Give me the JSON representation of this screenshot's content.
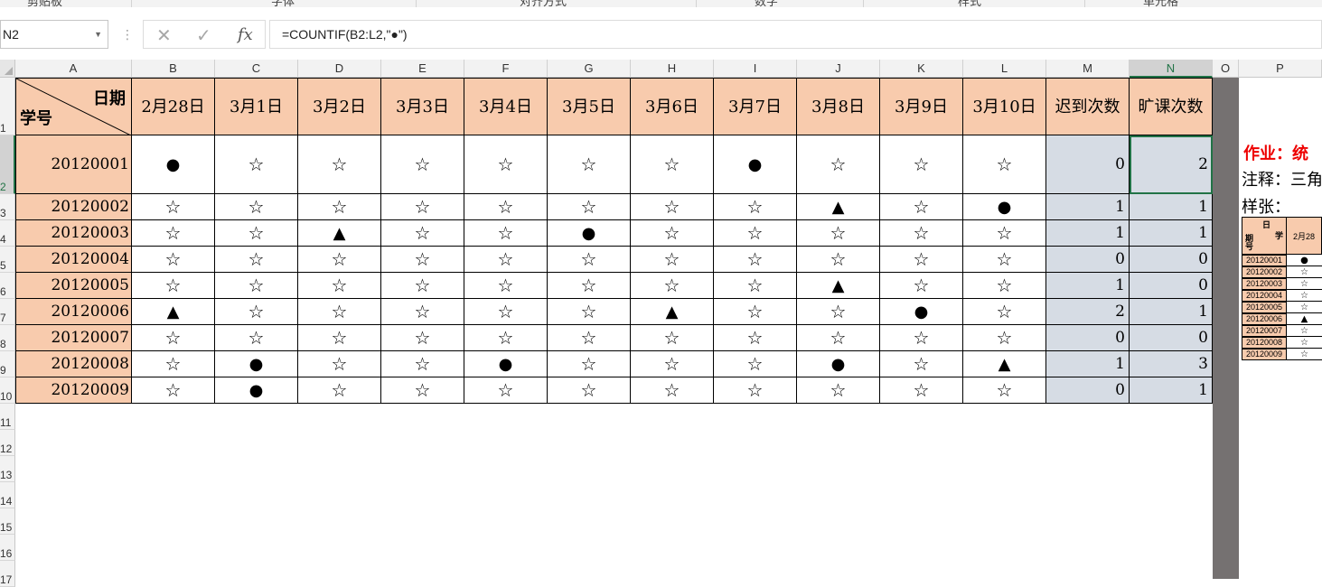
{
  "ribbon": {
    "groups": [
      "剪贴板",
      "字体",
      "对齐方式",
      "数字",
      "样式",
      "单元格"
    ]
  },
  "formula_bar": {
    "name_box": "N2",
    "cancel_icon": "x-icon",
    "enter_icon": "check-icon",
    "fx_label": "fx",
    "formula": "=COUNTIF(B2:L2,\"●\")"
  },
  "columns": [
    "A",
    "B",
    "C",
    "D",
    "E",
    "F",
    "G",
    "H",
    "I",
    "J",
    "K",
    "L",
    "M",
    "N",
    "O",
    "P"
  ],
  "selected_column": "N",
  "rows": [
    "1",
    "2",
    "3",
    "4",
    "5",
    "6",
    "7",
    "8",
    "9",
    "10",
    "11",
    "12",
    "13",
    "14",
    "15",
    "16",
    "17"
  ],
  "selected_row": "2",
  "table": {
    "corner_top": "日期",
    "corner_bottom": "学号",
    "dates": [
      "2月28日",
      "3月1日",
      "3月2日",
      "3月3日",
      "3月4日",
      "3月5日",
      "3月6日",
      "3月7日",
      "3月8日",
      "3月9日",
      "3月10日"
    ],
    "late_header": "迟到次数",
    "absent_header": "旷课次数",
    "records": [
      {
        "id": "20120001",
        "marks": [
          "●",
          "☆",
          "☆",
          "☆",
          "☆",
          "☆",
          "☆",
          "●",
          "☆",
          "☆",
          "☆"
        ],
        "late": "0",
        "absent": "2"
      },
      {
        "id": "20120002",
        "marks": [
          "☆",
          "☆",
          "☆",
          "☆",
          "☆",
          "☆",
          "☆",
          "☆",
          "▲",
          "☆",
          "●"
        ],
        "late": "1",
        "absent": "1"
      },
      {
        "id": "20120003",
        "marks": [
          "☆",
          "☆",
          "▲",
          "☆",
          "☆",
          "●",
          "☆",
          "☆",
          "☆",
          "☆",
          "☆"
        ],
        "late": "1",
        "absent": "1"
      },
      {
        "id": "20120004",
        "marks": [
          "☆",
          "☆",
          "☆",
          "☆",
          "☆",
          "☆",
          "☆",
          "☆",
          "☆",
          "☆",
          "☆"
        ],
        "late": "0",
        "absent": "0"
      },
      {
        "id": "20120005",
        "marks": [
          "☆",
          "☆",
          "☆",
          "☆",
          "☆",
          "☆",
          "☆",
          "☆",
          "▲",
          "☆",
          "☆"
        ],
        "late": "1",
        "absent": "0"
      },
      {
        "id": "20120006",
        "marks": [
          "▲",
          "☆",
          "☆",
          "☆",
          "☆",
          "☆",
          "▲",
          "☆",
          "☆",
          "●",
          "☆"
        ],
        "late": "2",
        "absent": "1"
      },
      {
        "id": "20120007",
        "marks": [
          "☆",
          "☆",
          "☆",
          "☆",
          "☆",
          "☆",
          "☆",
          "☆",
          "☆",
          "☆",
          "☆"
        ],
        "late": "0",
        "absent": "0"
      },
      {
        "id": "20120008",
        "marks": [
          "☆",
          "●",
          "☆",
          "☆",
          "●",
          "☆",
          "☆",
          "☆",
          "●",
          "☆",
          "▲"
        ],
        "late": "1",
        "absent": "3"
      },
      {
        "id": "20120009",
        "marks": [
          "☆",
          "●",
          "☆",
          "☆",
          "☆",
          "☆",
          "☆",
          "☆",
          "☆",
          "☆",
          "☆"
        ],
        "late": "0",
        "absent": "1"
      }
    ]
  },
  "side_notes": {
    "task": "作业：统",
    "note": "注释：三角",
    "sample": "样张："
  },
  "mini_table": {
    "corner_top": "日",
    "corner_right": "学",
    "corner_left": "期",
    "corner_bottom": "号",
    "first_date": "2月28",
    "ids": [
      "20120001",
      "20120002",
      "20120003",
      "20120004",
      "20120005",
      "20120006",
      "20120007",
      "20120008",
      "20120009"
    ],
    "first_marks": [
      "●",
      "☆",
      "☆",
      "☆",
      "☆",
      "▲",
      "☆",
      "☆",
      "☆"
    ]
  },
  "colors": {
    "header_fill": "#f8cbad",
    "count_fill": "#d6dce4",
    "selection": "#217346",
    "task_text": "#e00000"
  }
}
